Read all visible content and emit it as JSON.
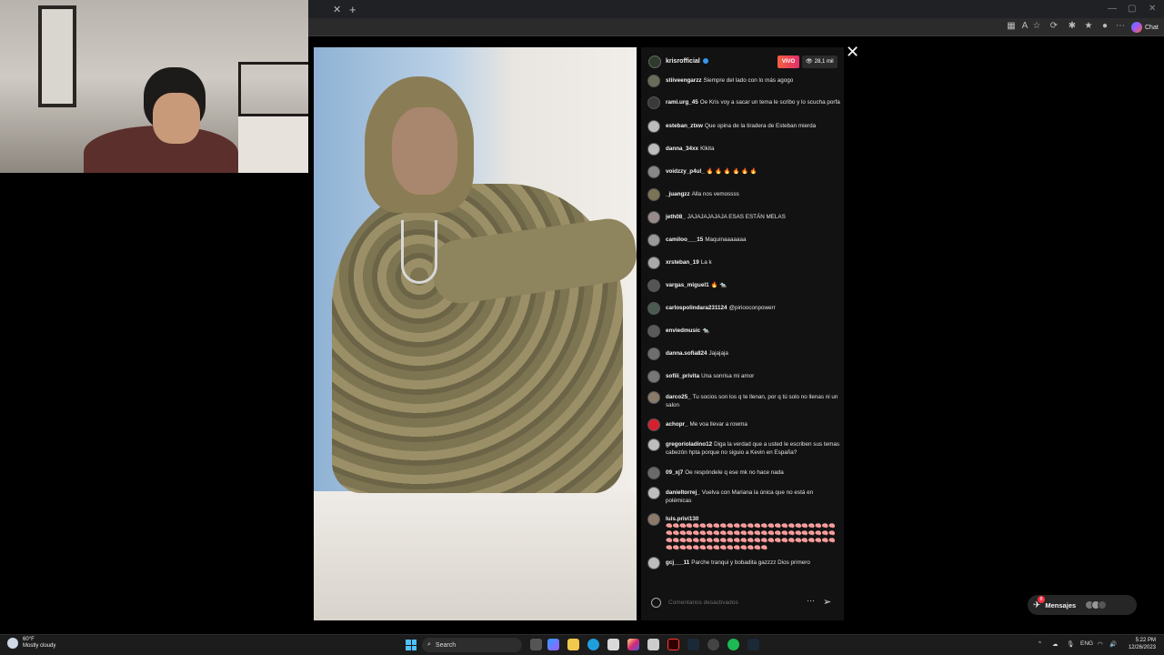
{
  "browser": {
    "tab_close": "✕",
    "new_tab": "+",
    "window_controls": [
      "—",
      "▢",
      "✕"
    ],
    "chat_label": "Chat"
  },
  "live": {
    "username": "krisrofficial",
    "live_badge": "VIVO",
    "viewers": "28,1 mil",
    "close": "✕",
    "comments": [
      {
        "user": "stiiveengarzz",
        "text": "Siempre del lado con lo más agogo"
      },
      {
        "user": "rami.urg_45",
        "text": "Oe Kris voy a sacar un tema le scribo y lo scucha porfa"
      },
      {
        "user": "esteban_ztxw",
        "text": "Que opina de la tiradera de Esteban mierda"
      },
      {
        "user": "danna_34xx",
        "text": "Klkita"
      },
      {
        "user": "voidzzy_p4ul_",
        "text": "🔥 🔥 🔥 🔥 🔥 🔥"
      },
      {
        "user": "_juangzz",
        "text": "Alla nos vemossss"
      },
      {
        "user": "jeth08_",
        "text": "JAJAJAJAJAJA ESAS ESTÁN MELAS"
      },
      {
        "user": "camiloo___15",
        "text": "Maquinaaaaaaa"
      },
      {
        "user": "xrsteban_19",
        "text": "La k"
      },
      {
        "user": "vargas_miguel1",
        "text": "🔥 🐀"
      },
      {
        "user": "carlospolindara231124",
        "text": "@piriooconpowerr"
      },
      {
        "user": "enviedmusic",
        "text": "🐀"
      },
      {
        "user": "danna.sofia824",
        "text": "Jajajaja"
      },
      {
        "user": "sofiii_privita",
        "text": "Una sonrisa mi amor"
      },
      {
        "user": "darco25_",
        "text": "Tu socios son los q te llenan, por q tú solo no llenas ni un salon"
      },
      {
        "user": "achopr_",
        "text": "Me voa llevar a rowma"
      },
      {
        "user": "gregorioladino12",
        "text": "Diga la verdad que a usted le escriben sus temas cabezón hpta porque no siguio a Kevin en España?"
      },
      {
        "user": "09_xj7",
        "text": "Oe respóndele q ese mk no hace nada"
      },
      {
        "user": "danieltorrej_",
        "text": "Vuelva con Mariana la única que no está en polémicas"
      },
      {
        "user": "luis.privi130",
        "text": "🧠🧠🧠🧠🧠🧠🧠🧠🧠🧠🧠🧠🧠🧠🧠🧠🧠🧠🧠🧠🧠🧠🧠🧠🧠🧠🧠🧠🧠🧠🧠🧠🧠🧠🧠🧠🧠🧠🧠🧠🧠🧠🧠🧠🧠🧠🧠🧠🧠🧠🧠🧠🧠🧠🧠🧠🧠🧠🧠🧠🧠🧠🧠🧠🧠🧠🧠🧠🧠🧠🧠🧠🧠🧠🧠🧠🧠🧠🧠🧠🧠🧠🧠🧠🧠🧠🧠🧠🧠🧠"
      },
      {
        "user": "gcj___11",
        "text": "Parche tranqui y bobadita gazzzz Dios primero"
      }
    ],
    "composer_placeholder": "Comentarios desactivados",
    "more": "···",
    "send": "➢"
  },
  "messages": {
    "label": "Mensajes",
    "badge": "8"
  },
  "taskbar": {
    "weather_temp": "60°F",
    "weather_desc": "Mostly cloudy",
    "search_label": "Search",
    "lang": "ENG",
    "time": "5:22 PM",
    "date": "12/26/2023"
  },
  "colors": {
    "accent_live": "#e1306c",
    "verified": "#3897f0",
    "panel_bg": "#121212"
  }
}
